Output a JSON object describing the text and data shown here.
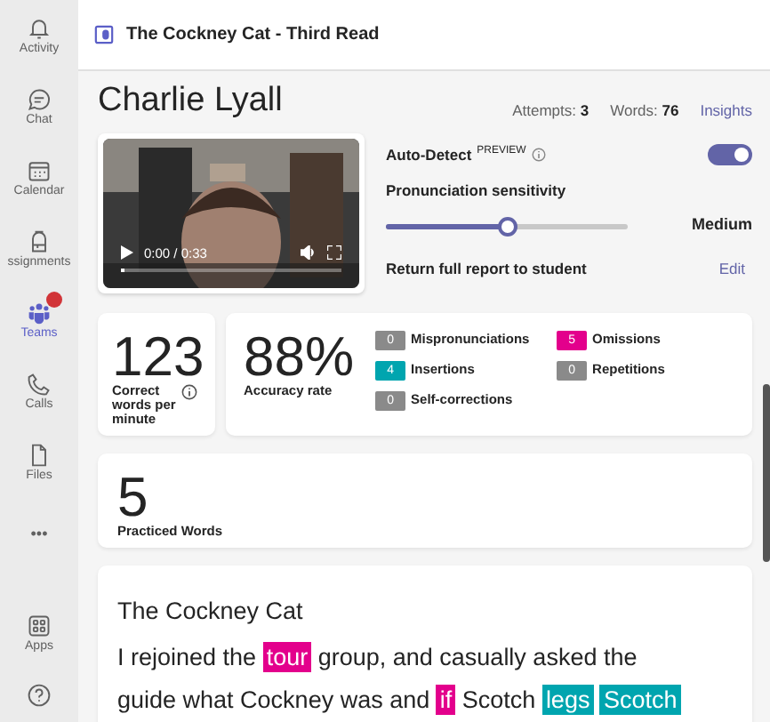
{
  "rail": [
    {
      "label": "Activity",
      "selected": false
    },
    {
      "label": "Chat",
      "selected": false
    },
    {
      "label": "Calendar",
      "selected": false
    },
    {
      "label": "ssignments",
      "selected": false
    },
    {
      "label": "Teams",
      "selected": true,
      "badge": true
    },
    {
      "label": "Calls",
      "selected": false
    },
    {
      "label": "Files",
      "selected": false
    },
    {
      "label": "•••",
      "selected": false
    }
  ],
  "rail_bottom": [
    {
      "label": "Apps"
    }
  ],
  "header": {
    "title": "The Cockney Cat - Third Read"
  },
  "student": {
    "name": "Charlie Lyall",
    "attempts_label": "Attempts:",
    "attempts": "3",
    "words_label": "Words:",
    "words": "76",
    "insights": "Insights"
  },
  "video": {
    "kind": "picture",
    "time": "0:00 / 0:33",
    "level": 0.02
  },
  "settings": {
    "auto_detect": "Auto-Detect",
    "preview": "PREVIEW",
    "auto_on": true,
    "sensitivity_label": "Pronunciation sensitivity",
    "level": 0.5,
    "sensitivity_value": "Medium",
    "return_label": "Return full report to student",
    "edit": "Edit"
  },
  "wpm": {
    "value": "123",
    "label": "Correct words per minute"
  },
  "accuracy": {
    "value": "88%",
    "label": "Accuracy rate",
    "counts": [
      {
        "count": "0",
        "label": "Mispronunciations",
        "color": "#8a8a8a"
      },
      {
        "count": "5",
        "label": "Omissions",
        "color": "#e3008c"
      },
      {
        "count": "4",
        "label": "Insertions",
        "color": "#00a5af"
      },
      {
        "count": "0",
        "label": "Repetitions",
        "color": "#8a8a8a"
      },
      {
        "count": "0",
        "label": "Self-corrections",
        "color": "#8a8a8a"
      }
    ]
  },
  "practiced": {
    "value": "5",
    "label": "Practiced Words"
  },
  "passage": {
    "title": "The Cockney Cat",
    "lines": [
      [
        {
          "text": "I rejoined the",
          "kind": "plain"
        },
        {
          "text": "tour",
          "kind": "omission"
        },
        {
          "text": "group, and casually asked the",
          "kind": "plain"
        }
      ],
      [
        {
          "text": "guide what Cockney was and",
          "kind": "plain"
        },
        {
          "text": "if",
          "kind": "omission"
        },
        {
          "text": "Scotch",
          "kind": "plain"
        },
        {
          "text": "legs",
          "kind": "insertion"
        },
        {
          "text": "Scotch",
          "kind": "insertion"
        }
      ]
    ]
  }
}
